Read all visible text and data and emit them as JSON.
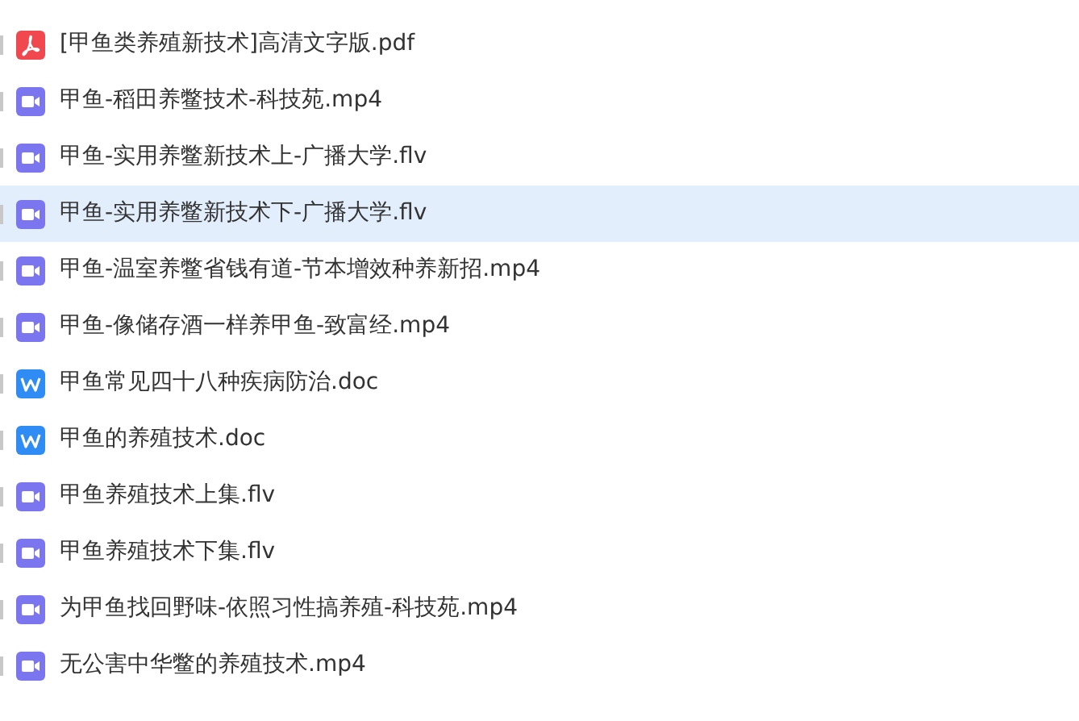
{
  "files": [
    {
      "kind": "pdf",
      "name": "[甲鱼类养殖新技术]高清文字版.pdf",
      "highlighted": false
    },
    {
      "kind": "video",
      "name": "甲鱼-稻田养鳖技术-科技苑.mp4",
      "highlighted": false
    },
    {
      "kind": "video",
      "name": "甲鱼-实用养鳖新技术上-广播大学.flv",
      "highlighted": false
    },
    {
      "kind": "video",
      "name": "甲鱼-实用养鳖新技术下-广播大学.flv",
      "highlighted": true
    },
    {
      "kind": "video",
      "name": "甲鱼-温室养鳖省钱有道-节本增效种养新招.mp4",
      "highlighted": false
    },
    {
      "kind": "video",
      "name": "甲鱼-像储存酒一样养甲鱼-致富经.mp4",
      "highlighted": false
    },
    {
      "kind": "word",
      "name": "甲鱼常见四十八种疾病防治.doc",
      "highlighted": false
    },
    {
      "kind": "word",
      "name": "甲鱼的养殖技术.doc",
      "highlighted": false
    },
    {
      "kind": "video",
      "name": "甲鱼养殖技术上集.flv",
      "highlighted": false
    },
    {
      "kind": "video",
      "name": "甲鱼养殖技术下集.flv",
      "highlighted": false
    },
    {
      "kind": "video",
      "name": "为甲鱼找回野味-依照习性搞养殖-科技苑.mp4",
      "highlighted": false
    },
    {
      "kind": "video",
      "name": "无公害中华鳖的养殖技术.mp4",
      "highlighted": false
    }
  ]
}
